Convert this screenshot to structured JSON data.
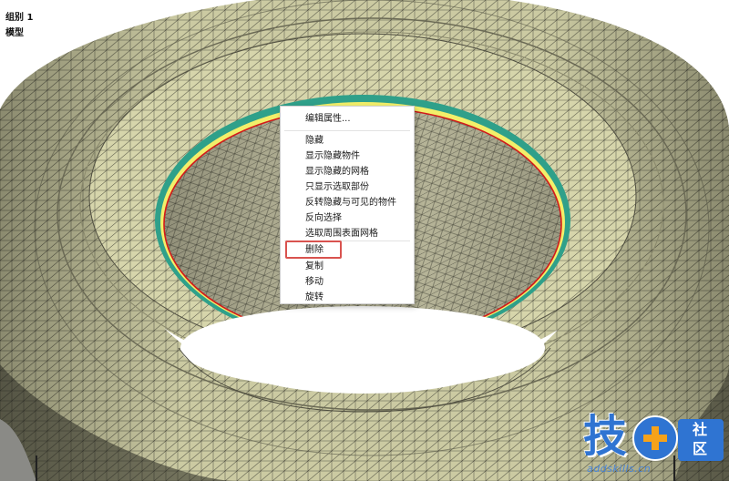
{
  "viewport": {
    "group_label": "组别 1",
    "model_label": "模型",
    "mesh_colors": {
      "surface": "#d6d5ab",
      "edge": "#5a5a4a",
      "inner_wall": "#b9b79a",
      "rim_teal": "#2fa08a",
      "rim_yellow": "#f2ef6a",
      "rim_red": "#d21a1a"
    }
  },
  "context_menu": {
    "items": [
      {
        "label": "编辑属性...",
        "group": 0
      },
      {
        "label": "隐藏",
        "group": 1
      },
      {
        "label": "显示隐藏物件",
        "group": 1
      },
      {
        "label": "显示隐藏的网格",
        "group": 1
      },
      {
        "label": "只显示选取部份",
        "group": 1
      },
      {
        "label": "反转隐藏与可见的物件",
        "group": 1
      },
      {
        "label": "反向选择",
        "group": 1
      },
      {
        "label": "选取周围表面网格",
        "group": 1
      },
      {
        "label": "删除",
        "group": 2,
        "highlighted": true
      },
      {
        "label": "复制",
        "group": 2
      },
      {
        "label": "移动",
        "group": 2
      },
      {
        "label": "旋转",
        "group": 2
      }
    ],
    "highlight_color": "#d9534f"
  },
  "watermark": {
    "char_main": "技",
    "char_box_1": "社",
    "char_box_2": "区",
    "url": "addskills.cn",
    "brand_blue": "#2f74d2",
    "brand_orange": "#f6a21a"
  }
}
